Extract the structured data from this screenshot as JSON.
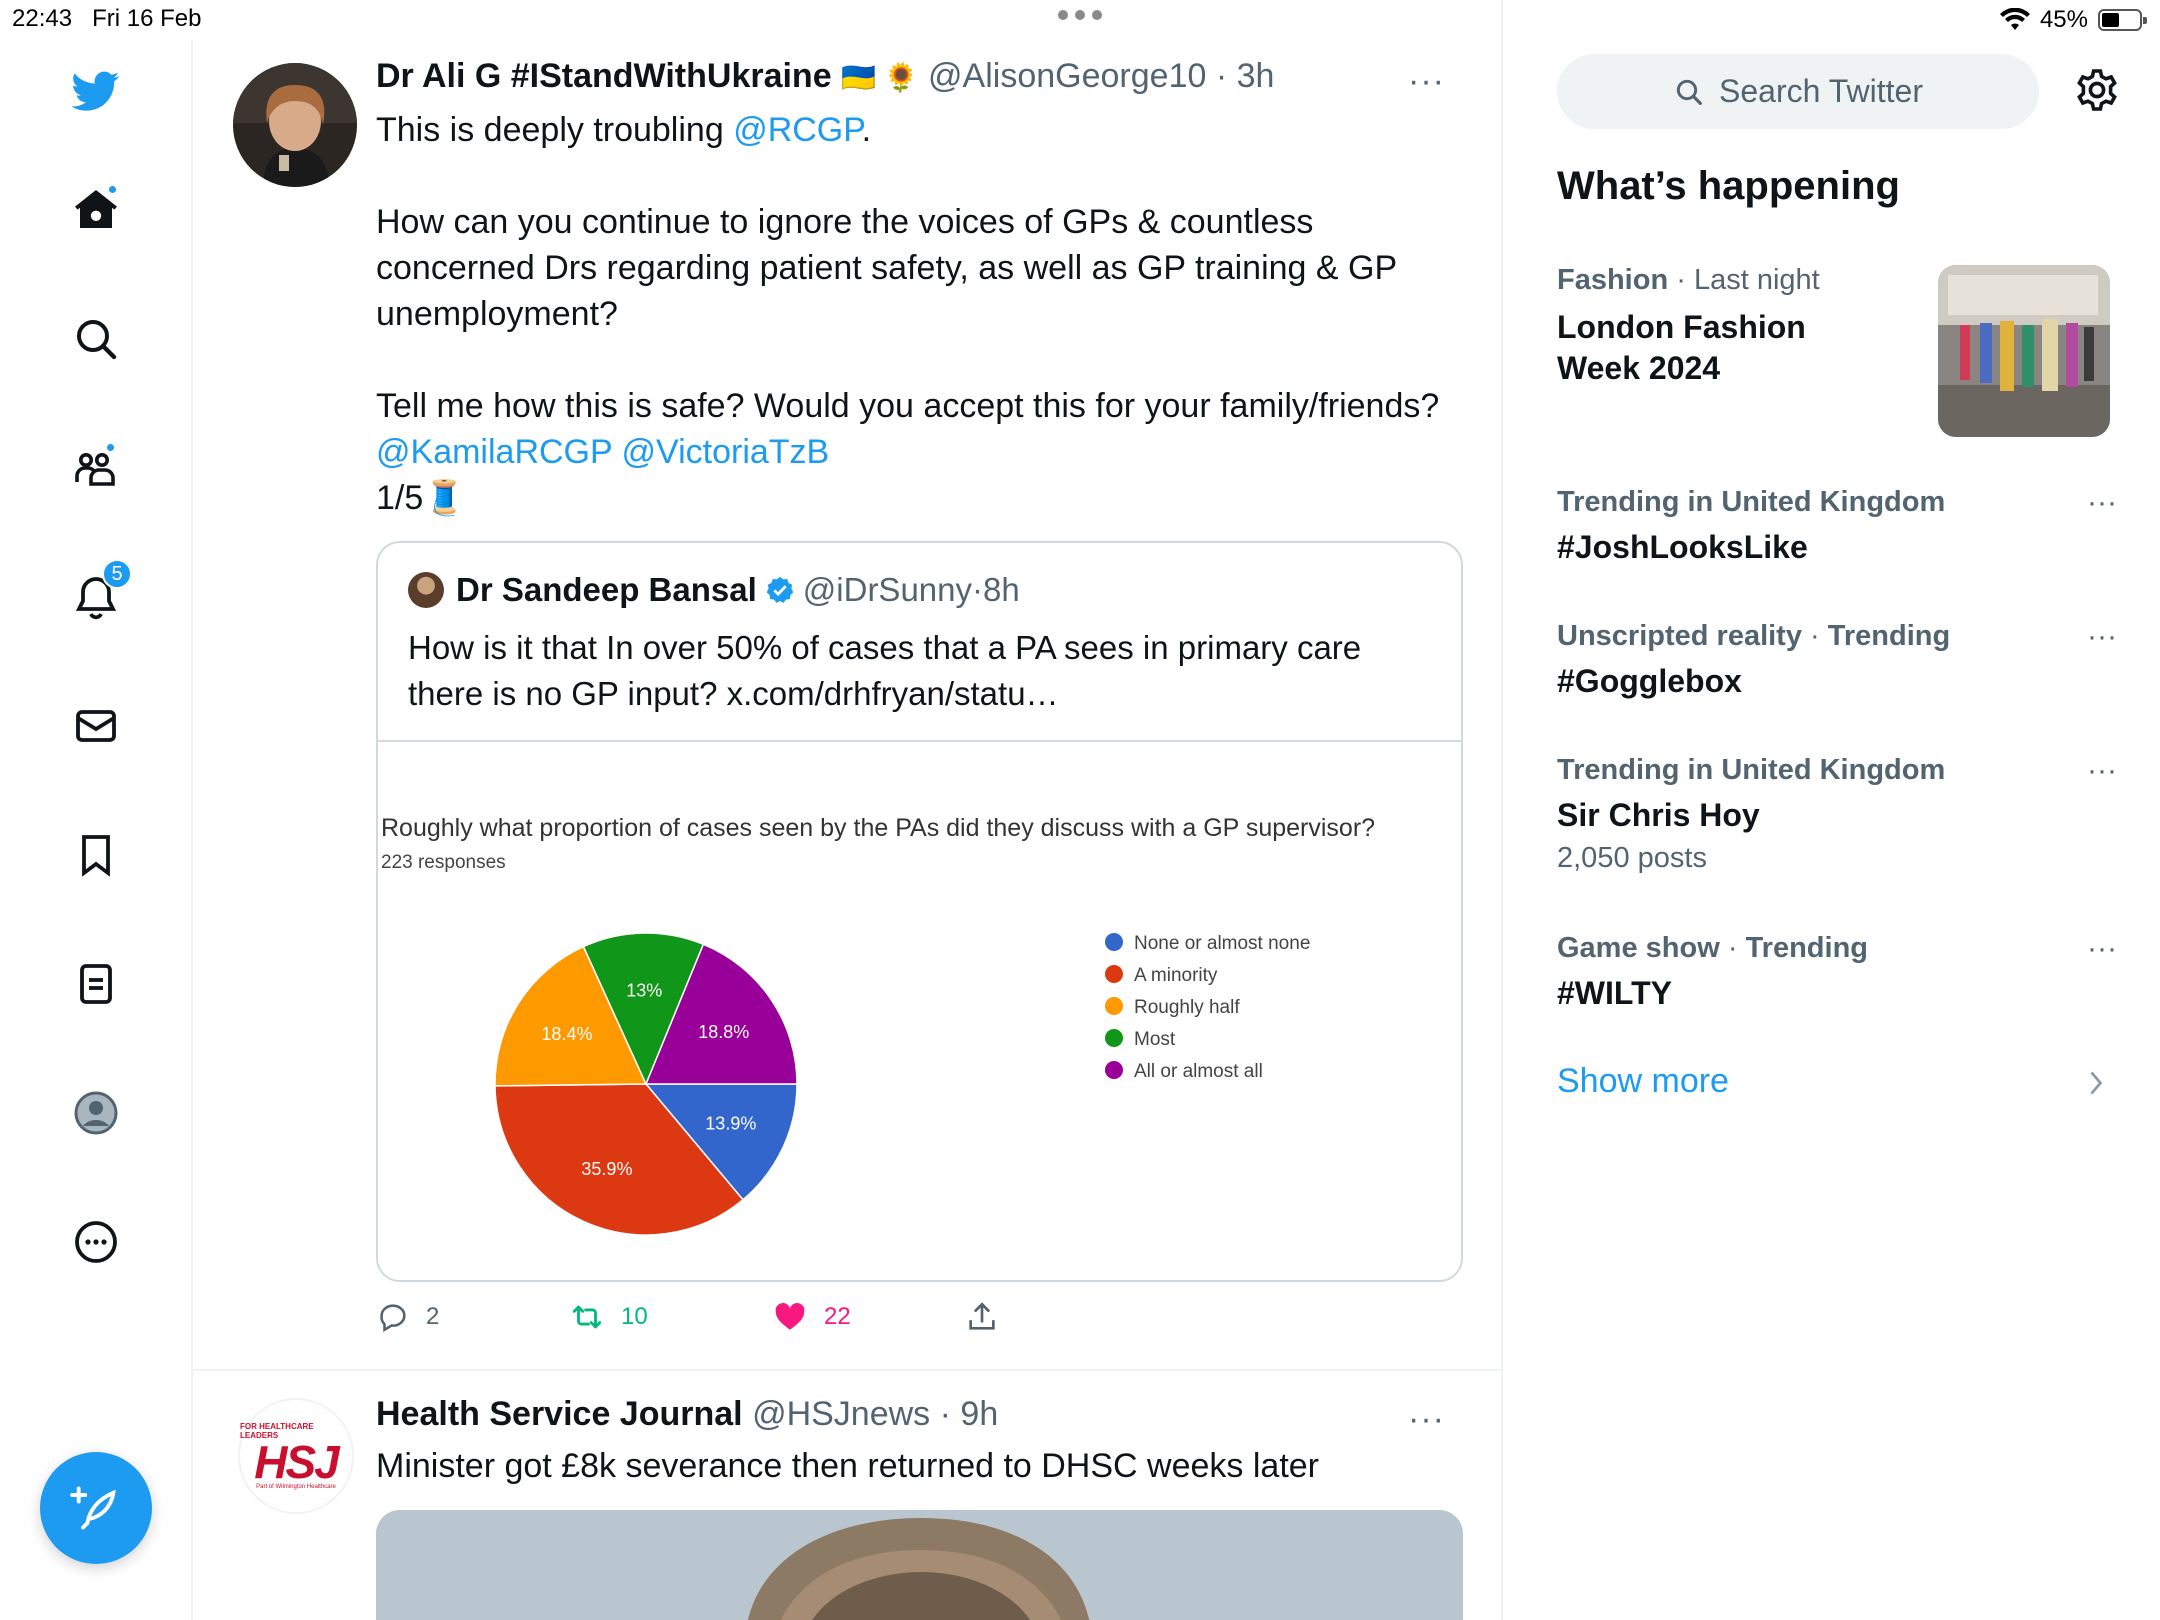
{
  "status_bar": {
    "time": "22:43",
    "date": "Fri 16 Feb",
    "battery": "45%"
  },
  "sidebar": {
    "items": [
      {
        "icon": "twitter-bird-logo-icon"
      },
      {
        "icon": "home-icon",
        "has_dot": true
      },
      {
        "icon": "search-icon"
      },
      {
        "icon": "communities-icon",
        "has_dot": true
      },
      {
        "icon": "notifications-bell-icon",
        "badge": "5"
      },
      {
        "icon": "messages-envelope-icon"
      },
      {
        "icon": "bookmark-icon"
      },
      {
        "icon": "lists-icon"
      },
      {
        "icon": "profile-avatar-icon"
      },
      {
        "icon": "more-circle-icon"
      }
    ],
    "compose_icon": "compose-feather-icon"
  },
  "tweet1": {
    "name": "Dr Ali G #IStandWithUkraine",
    "name_emoji": "🇺🇦 🌻",
    "handle": "@AlisonGeorge10",
    "time": "3h",
    "body": {
      "line1_prefix": "This is deeply troubling ",
      "line1_mention": "@RCGP",
      "line1_suffix": ".",
      "para2": "How can you continue to ignore the voices of GPs & countless concerned Drs regarding patient safety, as well as GP training & GP unemployment?",
      "para3": "Tell me how this is safe? Would you accept this for your family/friends?",
      "mention_a": "@KamilaRCGP",
      "mention_b": "@VictoriaTzB",
      "thread_count": "1/5",
      "thread_emoji": "🧵"
    },
    "quote": {
      "name": "Dr Sandeep Bansal",
      "handle": "@iDrSunny",
      "time": "8h",
      "text": "How is it that In over 50% of cases that a PA sees in primary care there is no GP input? x.com/drhfryan/statu…"
    },
    "actions": {
      "replies": "2",
      "retweets": "10",
      "likes": "22"
    }
  },
  "chart_data": {
    "type": "pie",
    "title": "Roughly what proportion of cases seen by the PAs did they discuss with a GP supervisor?",
    "subtitle": "223 responses",
    "legend_position": "right",
    "slices": [
      {
        "label": "None or almost none",
        "value": 13.9,
        "text": "13.9%",
        "color": "#3366cc"
      },
      {
        "label": "A minority",
        "value": 35.9,
        "text": "35.9%",
        "color": "#dc3912"
      },
      {
        "label": "Roughly half",
        "value": 18.4,
        "text": "18.4%",
        "color": "#ff9900"
      },
      {
        "label": "Most",
        "value": 13.0,
        "text": "13%",
        "color": "#109618"
      },
      {
        "label": "All or almost all",
        "value": 18.8,
        "text": "18.8%",
        "color": "#990099"
      }
    ]
  },
  "tweet2": {
    "name": "Health Service Journal",
    "handle": "@HSJnews",
    "time": "9h",
    "text": "Minister got £8k severance then returned to DHSC weeks later",
    "logo_text": "HSJ",
    "logo_tagline": "FOR HEALTHCARE LEADERS",
    "logo_subtagline": "Part of Wilmington Healthcare"
  },
  "right": {
    "search_placeholder": "Search Twitter",
    "section_title": "What’s happening",
    "trends": [
      {
        "category": "Fashion",
        "meta": "Last night",
        "topic": "London Fashion Week 2024",
        "count": ""
      },
      {
        "category": "Trending in United Kingdom",
        "meta": "",
        "topic": "#JoshLooksLike",
        "count": ""
      },
      {
        "category": "Unscripted reality",
        "meta": "Trending",
        "topic": "#Gogglebox",
        "count": ""
      },
      {
        "category": "Trending in United Kingdom",
        "meta": "",
        "topic": "Sir Chris Hoy",
        "count": "2,050 posts"
      },
      {
        "category": "Game show",
        "meta": "Trending",
        "topic": "#WILTY",
        "count": ""
      }
    ],
    "show_more": "Show more"
  },
  "colors": {
    "accent": "#1d9bf0",
    "like": "#f91880",
    "retweet": "#00ba7c",
    "text": "#0f1419",
    "muted": "#536471"
  }
}
